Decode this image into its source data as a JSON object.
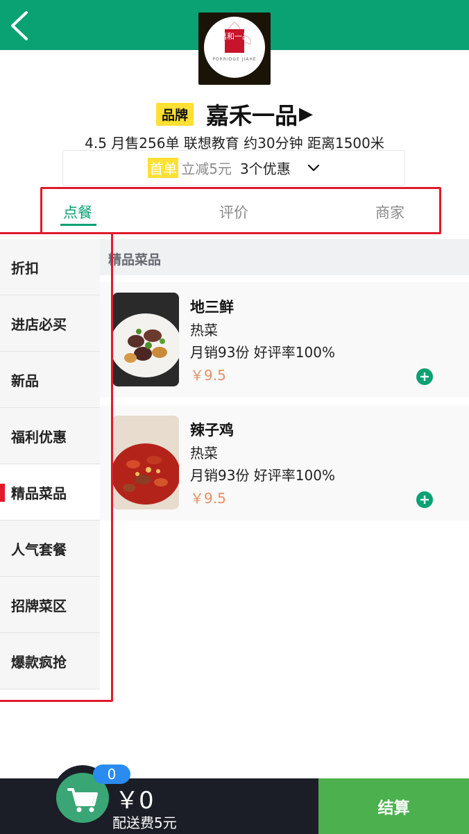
{
  "header": {
    "back_icon": "chevron-left-icon",
    "logo": {
      "mark_text": "嘉和一品",
      "sub_text": "PORRIDGE JIAHE"
    }
  },
  "shop": {
    "badge": "品牌",
    "name": "嘉禾一品",
    "arrow": "▶",
    "meta": "4.5 月售256单 联想教育 约30分钟 距离1500米",
    "promo": {
      "first_label": "首单",
      "discount": "立减5元",
      "count": "3个优惠"
    }
  },
  "tabs": [
    {
      "label": "点餐",
      "active": true
    },
    {
      "label": "评价",
      "active": false
    },
    {
      "label": "商家",
      "active": false
    }
  ],
  "sidebar": {
    "items": [
      {
        "label": "折扣"
      },
      {
        "label": "进店必买"
      },
      {
        "label": "新品"
      },
      {
        "label": "福利优惠"
      },
      {
        "label": "精品菜品",
        "active": true
      },
      {
        "label": "人气套餐"
      },
      {
        "label": "招牌菜区"
      },
      {
        "label": "爆款疯抢"
      }
    ]
  },
  "section": {
    "title": "精品菜品"
  },
  "dishes": [
    {
      "name": "地三鲜",
      "category": "热菜",
      "stats": "月销93份 好评率100%",
      "price": "￥9.5"
    },
    {
      "name": "辣子鸡",
      "category": "热菜",
      "stats": "月销93份 好评率100%",
      "price": "￥9.5"
    }
  ],
  "cart": {
    "badge_count": "0",
    "total": "￥0",
    "delivery_fee": "配送费5元",
    "checkout_label": "结算",
    "icon": "shopping-cart-icon"
  },
  "colors": {
    "brand_green": "#0aa173",
    "highlight_red": "#e01a2b",
    "badge_yellow": "#ffe033",
    "price_orange": "#e89064",
    "checkout_green": "#4db04e",
    "bar_dark": "#1b1e26",
    "badge_blue": "#2a8cf0"
  }
}
